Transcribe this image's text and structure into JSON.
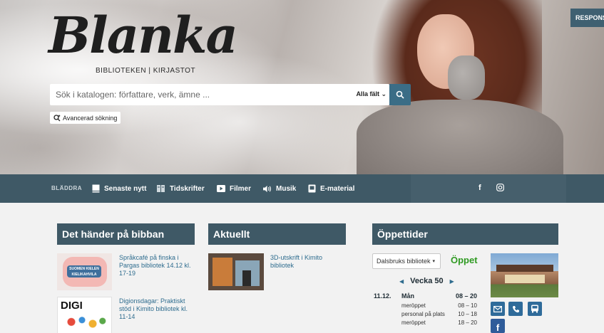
{
  "hero": {
    "logo": "Blanka",
    "subtitle": "BIBLIOTEKEN | KIRJASTOT",
    "search_placeholder": "Sök i katalogen: författare, verk, ämne ...",
    "search_fields": "Alla fält",
    "advanced_search": "Avancerad sökning",
    "respons_label": "RESPONS"
  },
  "nav": {
    "label": "BLÄDDRA",
    "items": [
      {
        "label": "Senaste nytt",
        "icon": "book-icon"
      },
      {
        "label": "Tidskrifter",
        "icon": "magazine-icon"
      },
      {
        "label": "Filmer",
        "icon": "play-icon"
      },
      {
        "label": "Musik",
        "icon": "speaker-icon"
      },
      {
        "label": "E-material",
        "icon": "ebook-icon"
      }
    ],
    "social": {
      "facebook": "f",
      "instagram": "instagram-icon"
    }
  },
  "events": {
    "heading": "Det händer på bibban",
    "items": [
      {
        "title": "Språkcafé på finska i Pargas bibliotek 14.12 kl. 17-19",
        "thumb_text": "SUOMEN KIELEN KIELIKAHVILA"
      },
      {
        "title": "Digionsdagar: Praktiskt stöd i Kimito bibliotek kl. 11-14",
        "thumb_text": "DIGI"
      }
    ]
  },
  "news": {
    "heading": "Aktuellt",
    "items": [
      {
        "title": "3D-utskrift i Kimito bibliotek"
      }
    ]
  },
  "hours": {
    "heading": "Öppettider",
    "library": "Dalsbruks bibliotek",
    "status": "Öppet",
    "week": "Vecka 50",
    "rows": [
      {
        "date": "11.12.",
        "name": "Mån",
        "time": "08 – 20"
      },
      {
        "date": "",
        "name": "meröppet",
        "time": "08 – 10"
      },
      {
        "date": "",
        "name": "personal på plats",
        "time": "10 – 18"
      },
      {
        "date": "",
        "name": "meröppet",
        "time": "18 – 20"
      }
    ],
    "contact": [
      "mail-icon",
      "phone-icon",
      "bus-icon"
    ],
    "facebook": "f"
  },
  "colors": {
    "nav_bg": "#3f5966",
    "accent": "#3b6d86",
    "link": "#2e6c8e",
    "open": "#2f9a22"
  }
}
